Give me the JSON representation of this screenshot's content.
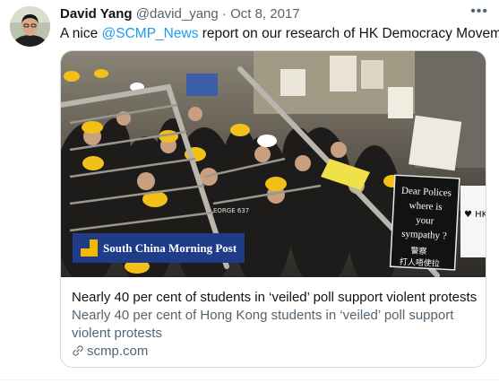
{
  "tweet": {
    "display_name": "David Yang",
    "handle": "@david_yang",
    "separator": "·",
    "date": "Oct 8, 2017",
    "more_icon": "more-icon",
    "text_prefix": "A nice ",
    "mention": "@SCMP_News",
    "text_suffix": " report on our research of HK Democracy Movement"
  },
  "card": {
    "logo_text": "South China Morning Post",
    "sign_lines": [
      "Dear Polices",
      "where is",
      "your",
      "sympathy ?"
    ],
    "sign_cjk": "警察",
    "sign_cjk2": "打人唔使拉",
    "side_sign": "I ♥ HK",
    "badge_text": "EORGE 637",
    "title": "Nearly 40 per cent of students in ‘veiled’ poll support violent protests",
    "description": "Nearly 40 per cent of Hong Kong students in ‘veiled’ poll support violent protests",
    "domain": "scmp.com",
    "link_icon": "link-icon"
  },
  "colors": {
    "accent": "#1d9bf0",
    "secondary_text": "#536471",
    "logo_bar": "#1f3c88",
    "logo_mark": "#f5b800"
  }
}
